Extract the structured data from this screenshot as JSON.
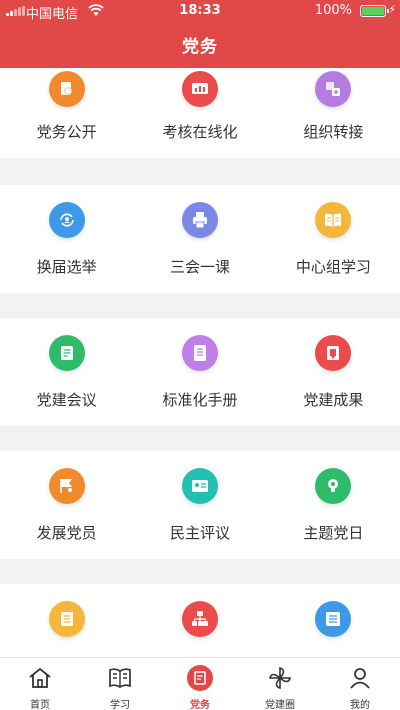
{
  "status_bar": {
    "carrier": "中国电信",
    "time": "18:33",
    "battery_pct": "100%",
    "battery_level": 1.0
  },
  "header": {
    "title": "党务"
  },
  "colors": {
    "primary": "#e14848",
    "orange": "#f08a2c",
    "red": "#ec4b4b",
    "purple": "#b67be0",
    "blue": "#3d9ae8",
    "indigo": "#7b88e6",
    "amber": "#f4b73b",
    "green": "#2ebc6a",
    "violet": "#c07ee8",
    "teal": "#22bfb3"
  },
  "grid": [
    [
      {
        "label": "党务公开",
        "icon": "document-search-icon",
        "color": "orange"
      },
      {
        "label": "考核在线化",
        "icon": "presentation-chart-icon",
        "color": "red"
      },
      {
        "label": "组织转接",
        "icon": "transfer-icon",
        "color": "purple"
      }
    ],
    [
      {
        "label": "换届选举",
        "icon": "refresh-user-icon",
        "color": "blue"
      },
      {
        "label": "三会一课",
        "icon": "printer-icon",
        "color": "indigo"
      },
      {
        "label": "中心组学习",
        "icon": "open-book-icon",
        "color": "amber"
      }
    ],
    [
      {
        "label": "党建会议",
        "icon": "meeting-notes-icon",
        "color": "green"
      },
      {
        "label": "标准化手册",
        "icon": "manual-icon",
        "color": "violet"
      },
      {
        "label": "党建成果",
        "icon": "achievement-book-icon",
        "color": "red"
      }
    ],
    [
      {
        "label": "发展党员",
        "icon": "flag-user-icon",
        "color": "orange"
      },
      {
        "label": "民主评议",
        "icon": "id-card-icon",
        "color": "teal"
      },
      {
        "label": "主题党日",
        "icon": "lightbulb-icon",
        "color": "green"
      }
    ],
    [
      {
        "label": "",
        "icon": "list-document-icon",
        "color": "amber"
      },
      {
        "label": "",
        "icon": "org-chart-icon",
        "color": "red"
      },
      {
        "label": "",
        "icon": "list-icon",
        "color": "blue"
      }
    ]
  ],
  "tabs": [
    {
      "label": "首页",
      "icon": "home-icon",
      "active": false
    },
    {
      "label": "学习",
      "icon": "book-icon",
      "active": false
    },
    {
      "label": "党务",
      "icon": "party-affairs-icon",
      "active": true
    },
    {
      "label": "党建圈",
      "icon": "pinwheel-icon",
      "active": false
    },
    {
      "label": "我的",
      "icon": "user-icon",
      "active": false
    }
  ]
}
